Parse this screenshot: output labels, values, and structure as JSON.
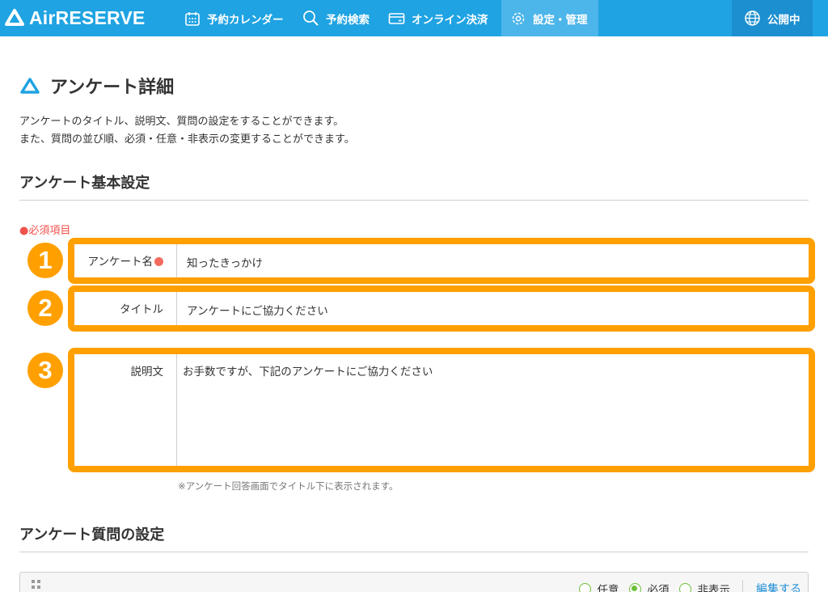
{
  "colors": {
    "nav": "#1fa3e2",
    "nav_active": "#4cb5ea",
    "highlight": "#ffa000",
    "required": "#f0524d",
    "link": "#1f8fd6",
    "radio": "#6fbf3b"
  },
  "app": {
    "logo_text": "AirRESERVE"
  },
  "nav": {
    "items": [
      {
        "label": "予約カレンダー",
        "icon": "calendar-icon"
      },
      {
        "label": "予約検索",
        "icon": "search-icon"
      },
      {
        "label": "オンライン決済",
        "icon": "card-icon"
      },
      {
        "label": "設定・管理",
        "icon": "gear-icon"
      }
    ],
    "public_label": "公開中",
    "public_icon": "globe-icon"
  },
  "page": {
    "title": "アンケート詳細",
    "description_line1": "アンケートのタイトル、説明文、質問の設定をすることができます。",
    "description_line2": "また、質問の並び順、必須・任意・非表示の変更することができます。"
  },
  "basic": {
    "section_title": "アンケート基本設定",
    "required_note": "●必須項目",
    "fields": [
      {
        "badge": "1",
        "label": "アンケート名",
        "value": "知ったきっかけ",
        "required": true
      },
      {
        "badge": "2",
        "label": "タイトル",
        "value": "アンケートにご協力ください"
      },
      {
        "badge": "3",
        "label": "説明文",
        "value": "お手数ですが、下記のアンケートにご協力ください"
      }
    ],
    "hint": "※アンケート回答画面でタイトル下に表示されます。"
  },
  "questions": {
    "section_title": "アンケート質問の設定",
    "options": [
      "任意",
      "必須",
      "非表示"
    ],
    "selected": "必須",
    "edit_label": "編集する"
  }
}
